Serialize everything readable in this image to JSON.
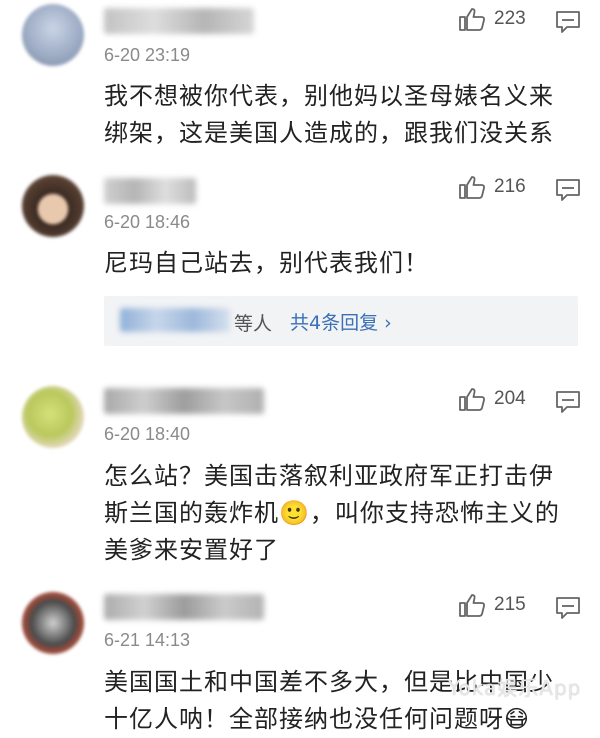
{
  "comments": [
    {
      "time": "6-20 23:19",
      "likes": "223",
      "text": "我不想被你代表，别他妈以圣母婊名义来绑架，这是美国人造成的，跟我们没关系"
    },
    {
      "time": "6-20 18:46",
      "likes": "216",
      "text": "尼玛自己站去，别代表我们！",
      "reply": {
        "etc": "等人",
        "link": "共4条回复 ›"
      }
    },
    {
      "time": "6-20 18:40",
      "likes": "204",
      "text": "怎么站？美国击落叙利亚政府军正打击伊斯兰国的轰炸机🙂，叫你支持恐怖主义的美爹来安置好了"
    },
    {
      "time": "6-21 14:13",
      "likes": "215",
      "text": "美国国土和中国差不多大，但是比中国少十亿人呐！全部接纳也没任何问题呀😷"
    }
  ],
  "watermark": "Yoka娱乐App",
  "icons": {
    "like": "thumbs-up-icon",
    "reply": "comment-bubble-icon"
  }
}
